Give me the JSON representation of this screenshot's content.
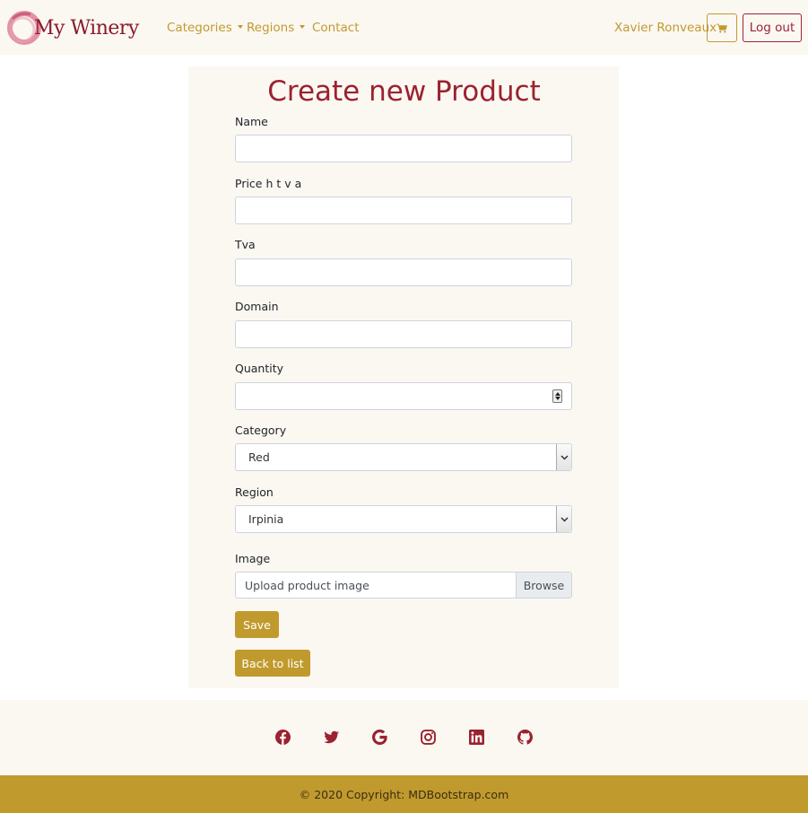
{
  "navbar": {
    "brand": "My Winery",
    "links": [
      {
        "label": "Categories"
      },
      {
        "label": "Regions"
      },
      {
        "label": "Contact"
      }
    ],
    "user_name": "Xavier Ronveaux",
    "cart_icon": "cart-icon",
    "logout_label": "Log out"
  },
  "form": {
    "title": "Create new Product",
    "name_label": "Name",
    "name_value": "",
    "price_label": "Price h t v a",
    "price_value": "",
    "tva_label": "Tva",
    "tva_value": "",
    "domain_label": "Domain",
    "domain_value": "",
    "quantity_label": "Quantity",
    "quantity_value": "",
    "category_label": "Category",
    "category_selected": "Red",
    "region_label": "Region",
    "region_selected": "Irpinia",
    "image_label": "Image",
    "image_placeholder": "Upload product image",
    "browse_label": "Browse",
    "save_label": "Save",
    "back_label": "Back to list"
  },
  "footer": {
    "social_icons": [
      "facebook-icon",
      "twitter-icon",
      "google-icon",
      "instagram-icon",
      "linkedin-icon",
      "github-icon"
    ],
    "copyright": "© 2020 Copyright: MDBootstrap.com"
  },
  "colors": {
    "brand": "#9b2230",
    "accent_gold": "#c19a2e",
    "cream": "#fbf8f2"
  }
}
